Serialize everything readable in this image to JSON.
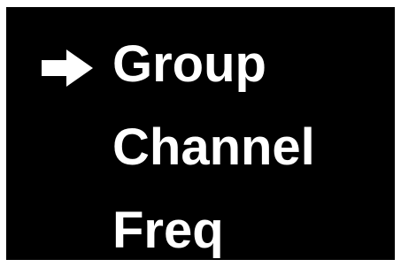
{
  "menu": {
    "selected_index": 0,
    "items": [
      {
        "label": "Group"
      },
      {
        "label": "Channel"
      },
      {
        "label": "Freq"
      }
    ],
    "pointer_icon": "arrow-right-icon"
  },
  "colors": {
    "background": "#000000",
    "text": "#ffffff",
    "frame": "#ffffff"
  }
}
